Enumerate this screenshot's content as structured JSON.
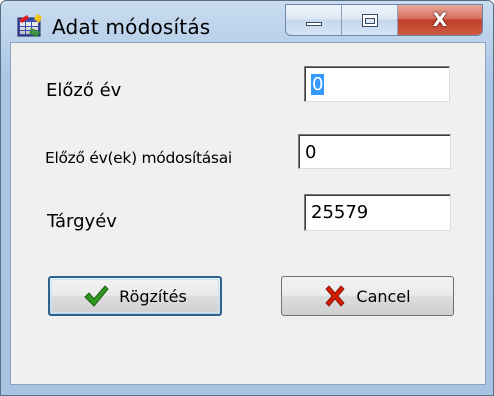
{
  "window": {
    "title": "Adat módosítás",
    "app_icon": "table-chart-icon",
    "controls": {
      "minimize_icon": "minimize-icon",
      "maximize_icon": "maximize-icon",
      "close_label": "X"
    }
  },
  "form": {
    "fields": [
      {
        "label": "Előző év",
        "value": "0"
      },
      {
        "label": "Előző év(ek) módosításai",
        "value": "0"
      },
      {
        "label": "Tárgyév",
        "value": "25579"
      }
    ]
  },
  "buttons": {
    "save": {
      "label": "Rögzítés",
      "icon": "checkmark-icon",
      "color": "#2e9a1d"
    },
    "cancel": {
      "label": "Cancel",
      "icon": "red-x-icon",
      "color": "#d11a00"
    }
  },
  "colors": {
    "frame": "#b9d1ea",
    "client": "#f0f0f0",
    "selection": "#3399ff",
    "close_button": "#c13f2a"
  }
}
